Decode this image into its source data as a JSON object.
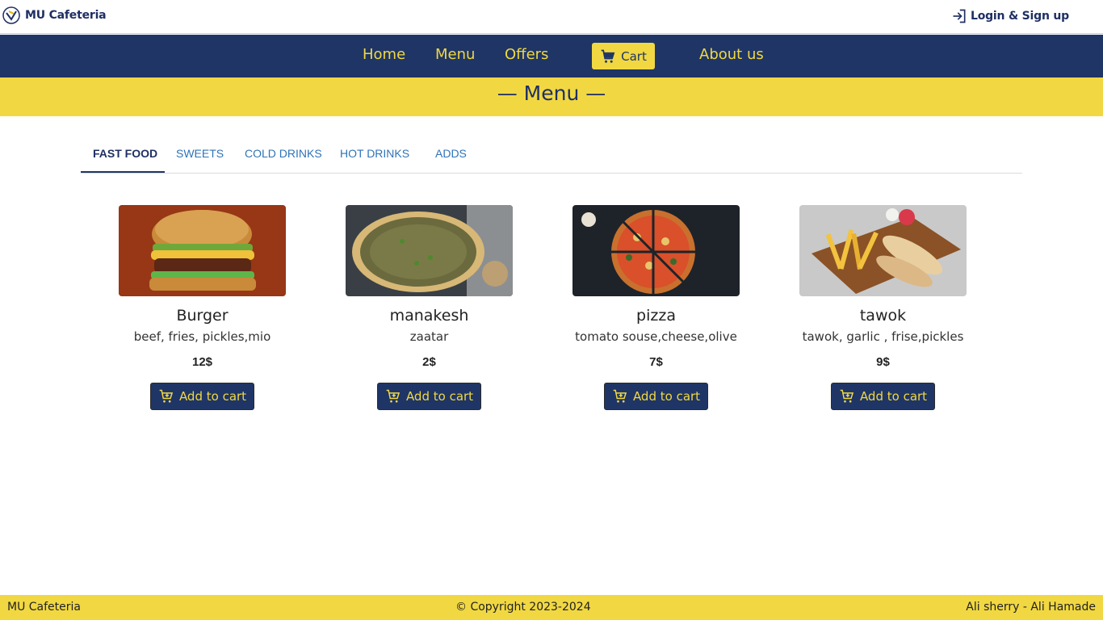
{
  "header": {
    "brand": "MU Cafeteria",
    "login_label": "Login & Sign up"
  },
  "nav": {
    "home": "Home",
    "menu": "Menu",
    "offers": "Offers",
    "cart": "Cart",
    "about": "About us"
  },
  "banner": {
    "title": "— Menu —"
  },
  "tabs": [
    {
      "label": "FAST FOOD",
      "active": true
    },
    {
      "label": "SWEETS",
      "active": false
    },
    {
      "label": "COLD DRINKS",
      "active": false
    },
    {
      "label": "HOT DRINKS",
      "active": false
    },
    {
      "label": "ADDS",
      "active": false
    }
  ],
  "products": [
    {
      "name": "Burger",
      "description": "beef, fries, pickles,mio",
      "price": "12$",
      "button": "Add to cart",
      "image": "burger-image"
    },
    {
      "name": "manakesh",
      "description": "zaatar",
      "price": "2$",
      "button": "Add to cart",
      "image": "manakesh-image"
    },
    {
      "name": "pizza",
      "description": "tomato souse,cheese,olive",
      "price": "7$",
      "button": "Add to cart",
      "image": "pizza-image"
    },
    {
      "name": "tawok",
      "description": "tawok, garlic , frise,pickles",
      "price": "9$",
      "button": "Add to cart",
      "image": "tawok-image"
    }
  ],
  "footer": {
    "left": "MU Cafeteria",
    "center": "© Copyright 2023-2024",
    "right": "Ali sherry - Ali Hamade"
  },
  "colors": {
    "navy": "#1f3566",
    "yellow": "#f1d842",
    "link_blue": "#2f73b8"
  }
}
